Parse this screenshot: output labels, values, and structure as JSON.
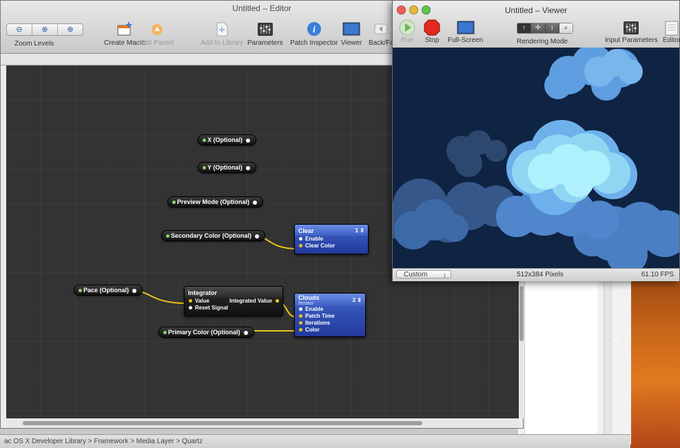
{
  "editor": {
    "title": "Untitled – Editor",
    "zoom_label": "Zoom Levels",
    "zoom_buttons": [
      "⊖",
      "⊕",
      "⊕"
    ],
    "tools": {
      "create_macro": "Create Macro",
      "edit_parent": "Edit Parent",
      "add_to_library": "Add to Library",
      "parameters": "Parameters",
      "patch_inspector": "Patch Inspector",
      "viewer": "Viewer",
      "back_forward": "Back/Fo"
    },
    "pills": {
      "x": "X (Optional)",
      "y": "Y (Optional)",
      "preview_mode": "Preview Mode (Optional)",
      "secondary_color": "Secondary Color (Optional)",
      "pace": "Pace (Optional)",
      "primary_color": "Primary Color (Optional)"
    },
    "patches": {
      "clear": {
        "title": "Clear",
        "count": "1",
        "ports": [
          "Enable",
          "Clear Color"
        ]
      },
      "integrator": {
        "title": "Integrator",
        "inputs": [
          "Value",
          "Reset Signal"
        ],
        "output": "Integrated Value"
      },
      "clouds": {
        "title": "Clouds",
        "subtitle": "Iterator",
        "count": "2",
        "ports": [
          "Enable",
          "Patch Time",
          "Iterations",
          "Color"
        ]
      }
    }
  },
  "viewer": {
    "title": "Untitled – Viewer",
    "tools": {
      "run": "Run",
      "stop": "Stop",
      "full_screen": "Full-Screen",
      "rendering_mode": "Rendering Mode",
      "input_parameters": "Input Parameters",
      "editor": "Editor"
    },
    "render_modes": [
      "↑",
      "✛",
      "↕",
      "⌕"
    ],
    "size_select": "Custom",
    "resolution": "512x384 Pixels",
    "fps": "61.10 FPS"
  },
  "background": {
    "status_path": "ac OS X Developer Library > Framework > Media Layer > Quartz",
    "side_letter": "e"
  }
}
